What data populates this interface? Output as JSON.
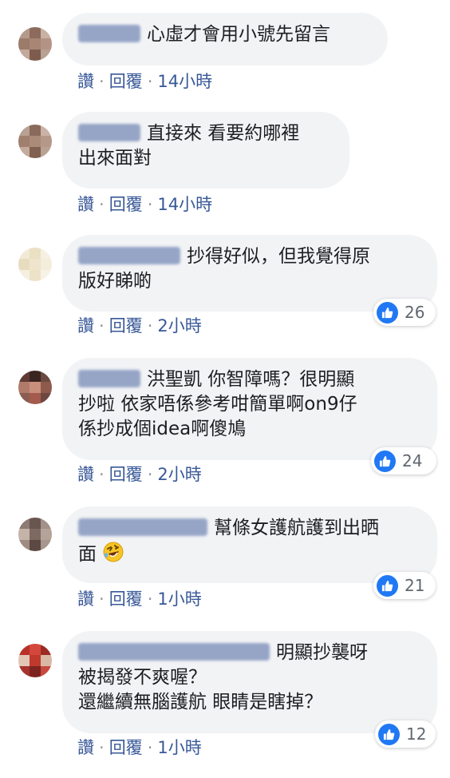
{
  "actions": {
    "like": "讚",
    "reply": "回覆",
    "separator": "·"
  },
  "colors": {
    "link": "#385898",
    "bubble": "#f2f3f5",
    "like_blue": "#2078f4"
  },
  "comments": [
    {
      "name": "■■■■",
      "text_lines": [
        "心虛才會用小號先留言"
      ],
      "time": "14小時",
      "likes": null
    },
    {
      "name": "■■■■",
      "text_lines": [
        "直接來 看要約哪裡",
        "出來面對"
      ],
      "time": "14小時",
      "likes": null
    },
    {
      "name": "Smart Cu",
      "text_lines": [
        "抄得好似，但我覺得原",
        "版好睇啲"
      ],
      "time": "2小時",
      "likes": "26"
    },
    {
      "name": "■■■■",
      "text_lines": [
        "洪聖凱 你智障嗎？很明顯",
        "抄啦 依家唔係參考咁簡單啊on9仔",
        "係抄成個idea啊傻鳩"
      ],
      "time": "2小時",
      "likes": "24"
    },
    {
      "name": "Hokwin Ho",
      "text_lines": [
        "幫條女護航護到出晒",
        "面"
      ],
      "time": "1小時",
      "likes": "21",
      "emoji": "rofl-emoji"
    },
    {
      "name": "Chun Seong Wong",
      "text_lines": [
        "明顯抄襲呀",
        "被揭發不爽喔？",
        "還繼續無腦護航 眼睛是瞎掉？"
      ],
      "time": "1小時",
      "likes": "12"
    }
  ]
}
